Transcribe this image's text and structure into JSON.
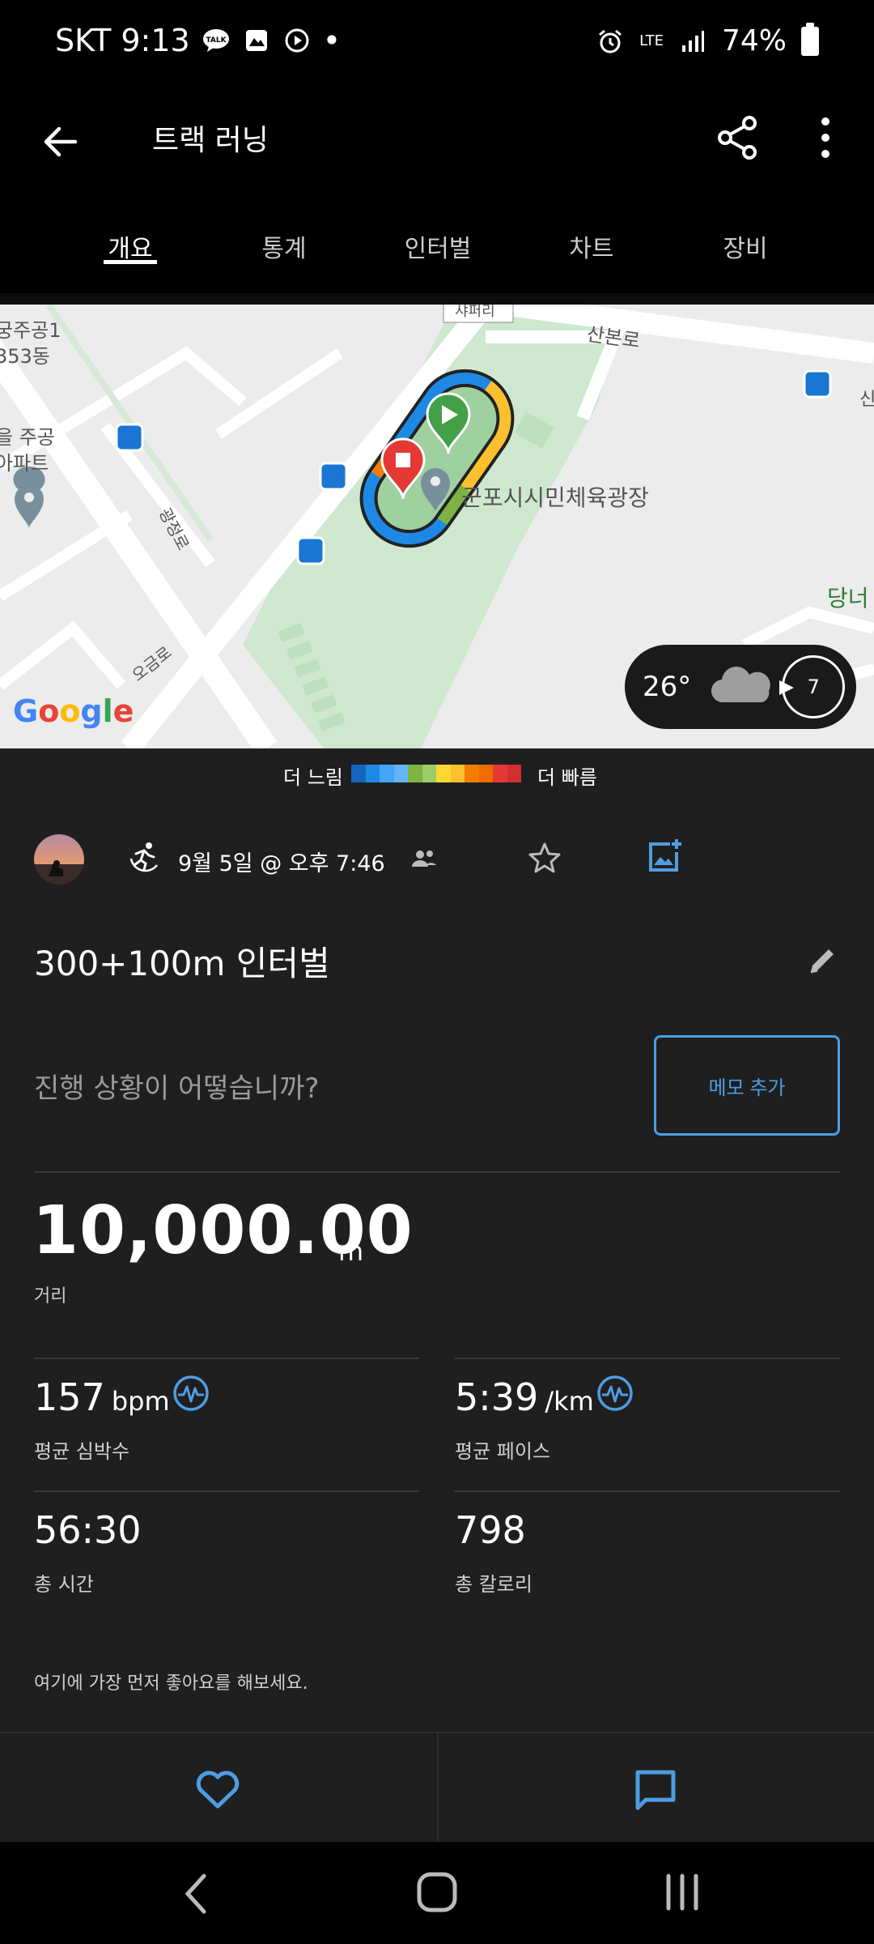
{
  "status_bar": {
    "carrier_time": "SKT 9:13",
    "notif_dot": "•",
    "network": "LTE",
    "battery": "74%"
  },
  "app_bar": {
    "title": "트랙 러닝"
  },
  "tabs": [
    {
      "label": "개요",
      "active": true
    },
    {
      "label": "통계",
      "active": false
    },
    {
      "label": "인터벌",
      "active": false
    },
    {
      "label": "차트",
      "active": false
    },
    {
      "label": "장비",
      "active": false
    }
  ],
  "map": {
    "labels": {
      "label_1": "샤퍼리",
      "label_2": "산본로",
      "label_3": "궁주공1",
      "label_4": "353동",
      "label_5": "을 주공",
      "label_6": "아파트",
      "label_7": "광정로",
      "label_8": "군포시시민체육광장",
      "label_9": "오금로",
      "label_10": "당너",
      "label_11": "신"
    },
    "google_logo": "Google",
    "weather": {
      "temp": "26°",
      "uv": "7"
    }
  },
  "legend": {
    "slow": "더 느림",
    "fast": "더 빠름",
    "colors": [
      "#1565c0",
      "#1e88e5",
      "#42a5f5",
      "#64b5f6",
      "#7cb342",
      "#9ccc65",
      "#fdd835",
      "#fbc02d",
      "#f57c00",
      "#ef6c00",
      "#e53935",
      "#d32f2f"
    ]
  },
  "activity": {
    "date": "9월 5일 @ 오후 7:46",
    "title": "300+100m 인터벌",
    "prompt": "진행 상황이 어떻습니까?",
    "memo_button": "메모 추가",
    "distance": {
      "value": "10,000.00",
      "unit": "m",
      "label": "거리"
    },
    "heart_rate": {
      "value": "157",
      "unit": "bpm",
      "label": "평균 심박수"
    },
    "pace": {
      "value": "5:39",
      "unit": "/km",
      "label": "평균 페이스"
    },
    "time": {
      "value": "56:30",
      "label": "총 시간"
    },
    "calories": {
      "value": "798",
      "label": "총 칼로리"
    },
    "like_prompt": "여기에 가장 먼저 좋아요를 해보세요."
  },
  "colors": {
    "accent": "#4e9de3",
    "background": "#1f1f1f"
  }
}
